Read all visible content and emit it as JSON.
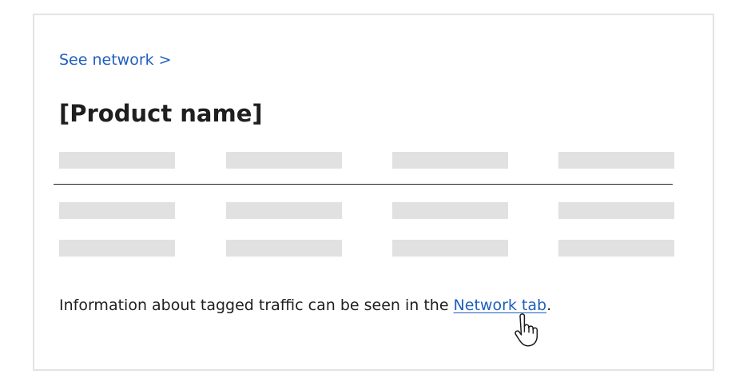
{
  "nav": {
    "back_link": "See network >"
  },
  "product": {
    "title": "[Product name]"
  },
  "info": {
    "prefix": "Information about tagged traffic can be seen in the ",
    "link": "Network tab",
    "suffix": "."
  },
  "colors": {
    "link": "#1f5fbf",
    "text": "#1f1f1f",
    "skeleton": "#e1e1e1",
    "border": "#e3e3e3"
  },
  "icons": {
    "cursor": "hand-pointer-icon"
  }
}
